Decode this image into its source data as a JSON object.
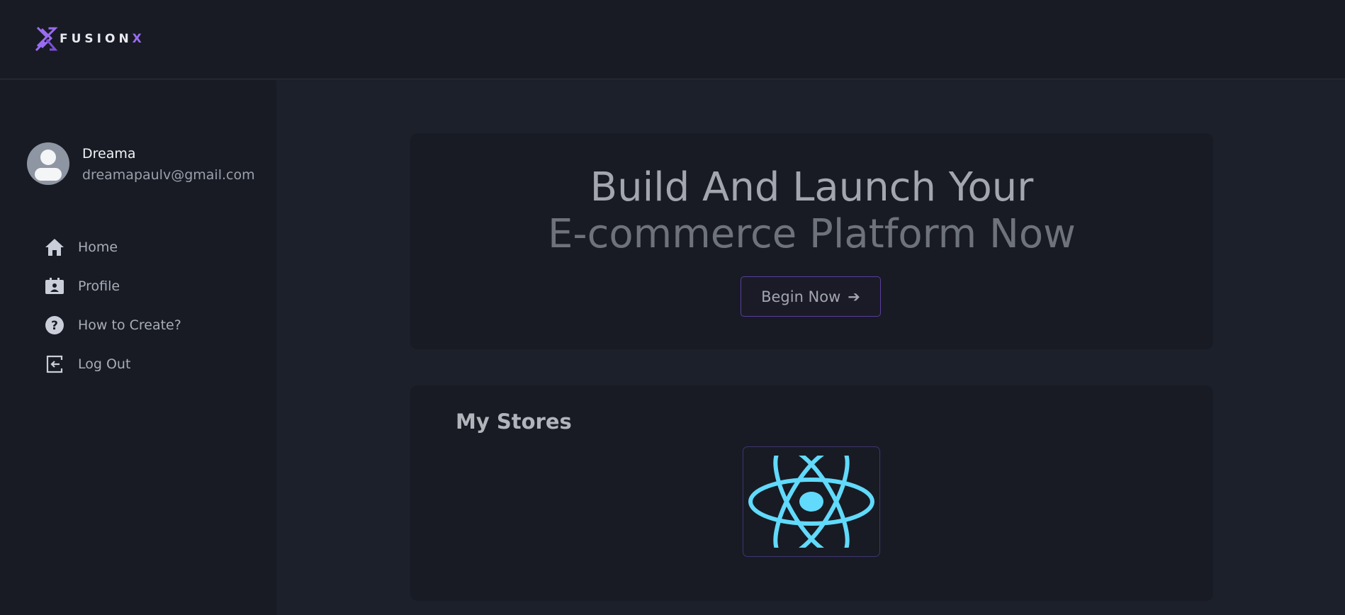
{
  "brand": {
    "name_main": "FUSION",
    "name_accent": "X",
    "accent_color": "#9a6cf0"
  },
  "user": {
    "name": "Dreama",
    "email": "dreamapaulv@gmail.com"
  },
  "sidebar": {
    "items": [
      {
        "label": "Home",
        "icon": "home-icon"
      },
      {
        "label": "Profile",
        "icon": "id-badge-icon"
      },
      {
        "label": "How to Create?",
        "icon": "question-circle-icon"
      },
      {
        "label": "Log Out",
        "icon": "logout-icon"
      }
    ]
  },
  "hero": {
    "line1": "Build And Launch Your",
    "line2": "E-commerce Platform Now",
    "button_label": "Begin Now",
    "button_icon": "arrow-right-icon"
  },
  "stores": {
    "title": "My Stores",
    "items": [
      {
        "icon": "react-logo-icon",
        "color": "#61dafb"
      }
    ]
  }
}
